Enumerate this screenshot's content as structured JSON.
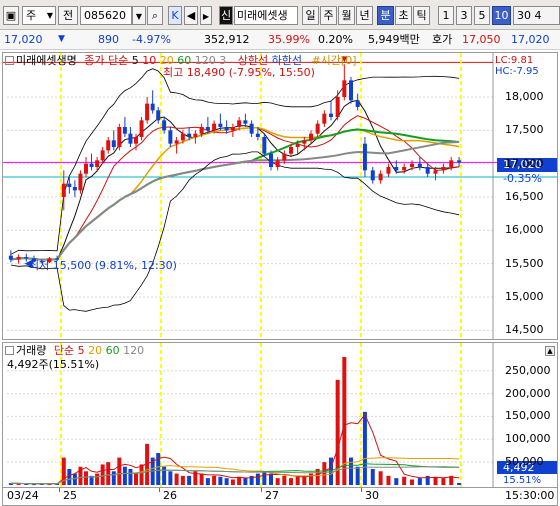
{
  "toolbar": {
    "market": "주",
    "period_btn": "전",
    "code": "085620",
    "k_btn": "K",
    "sin_badge": "신",
    "name": "미래에셋생",
    "periods": [
      "일",
      "주",
      "월",
      "년",
      "분",
      "초",
      "틱"
    ],
    "selected_period": "분",
    "intervals": [
      "1",
      "3",
      "5",
      "10",
      "30"
    ],
    "selected_interval": "10",
    "partial": "30 4"
  },
  "info": {
    "price": "17,020",
    "change": "890",
    "change_pct": "-4.97%",
    "volume": "352,912",
    "ratio": "35.99%",
    "turnover_pct": "0.20%",
    "amount": "5,949백만",
    "quote_label": "호가",
    "quote_price": "17,050",
    "quote_price2": "17,020"
  },
  "price_pane": {
    "legend_name": "미래에셋생명",
    "legend_ma_label": "종가 단순",
    "legend_ma_periods": [
      "5",
      "10",
      "20",
      "60",
      "120"
    ],
    "legend_extra_num": "3",
    "legend_limit": "상한선",
    "legend_lower": "하한선",
    "legend_time": "#시간[0]",
    "lc_label": "LC:9.81",
    "hc_label": "HC:-7.95",
    "high_annotation": "최고 18,490 (-7.95%, 15:50)",
    "low_annotation": "최저 15,500 (9.81%, 12:30)",
    "current_price_tag": "17,020",
    "current_pct_tag": "-0.35%",
    "y_ticks": [
      "18,000",
      "17,500",
      "17,000",
      "16,500",
      "16,000",
      "15,500",
      "15,000",
      "14,500"
    ]
  },
  "volume_pane": {
    "legend_label": "거래량",
    "legend_ma_label": "단순",
    "legend_ma_periods": [
      "5",
      "20",
      "60",
      "120"
    ],
    "volume_annotation": "4,492주(15.51%)",
    "current_volume_tag": "4,492",
    "current_volume_pct": "15.51%",
    "y_ticks": [
      "250,000",
      "200,000",
      "150,000",
      "100,000",
      "50,000"
    ]
  },
  "x_axis": {
    "labels": [
      "03/24",
      "25",
      "26",
      "27",
      "30"
    ],
    "time_label": "15:30:00"
  },
  "colors": {
    "up": "#e01010",
    "down": "#1040d0",
    "ma5": "#111111",
    "ma10": "#d01010",
    "ma20": "#e0a000",
    "ma60": "#10a020",
    "ma120": "#888888",
    "day_marker": "#ffff00",
    "current_line": "#ff00ff",
    "prev_line": "#00b0d0",
    "bollinger": "#000000"
  },
  "chart_data": {
    "type": "candlestick",
    "title": "",
    "price_axis": {
      "ylim": [
        14400,
        18600
      ]
    },
    "volume_axis": {
      "ylim": [
        0,
        280000
      ]
    },
    "high": {
      "value": 18490,
      "time": "15:50"
    },
    "low": {
      "value": 15500,
      "time": "12:30"
    },
    "current": 17020,
    "reference_price": 16800,
    "day_boundaries": [
      "25",
      "26",
      "27",
      "30"
    ],
    "candles": [
      [
        15620,
        15700,
        15520,
        15560
      ],
      [
        15560,
        15640,
        15500,
        15600
      ],
      [
        15600,
        15650,
        15530,
        15580
      ],
      [
        15580,
        15620,
        15520,
        15540
      ],
      [
        15540,
        15560,
        15500,
        15520
      ],
      [
        15520,
        15600,
        15510,
        15580
      ],
      [
        15580,
        15620,
        15540,
        15560
      ],
      [
        16500,
        16900,
        16300,
        16700
      ],
      [
        16700,
        16800,
        16550,
        16650
      ],
      [
        16650,
        16750,
        16500,
        16600
      ],
      [
        16600,
        16900,
        16550,
        16850
      ],
      [
        16850,
        17100,
        16800,
        17000
      ],
      [
        17000,
        17150,
        16900,
        16950
      ],
      [
        16950,
        17100,
        16900,
        17050
      ],
      [
        17050,
        17250,
        17000,
        17200
      ],
      [
        17200,
        17400,
        17150,
        17350
      ],
      [
        17350,
        17500,
        17200,
        17250
      ],
      [
        17250,
        17600,
        17200,
        17550
      ],
      [
        17550,
        17700,
        17400,
        17450
      ],
      [
        17450,
        17550,
        17250,
        17300
      ],
      [
        17300,
        17450,
        17200,
        17400
      ],
      [
        17400,
        17700,
        17350,
        17650
      ],
      [
        17650,
        18000,
        17600,
        17900
      ],
      [
        17900,
        18100,
        17750,
        17800
      ],
      [
        17800,
        17850,
        17600,
        17650
      ],
      [
        17650,
        17700,
        17450,
        17500
      ],
      [
        17500,
        17550,
        17250,
        17300
      ],
      [
        17300,
        17400,
        17150,
        17350
      ],
      [
        17350,
        17500,
        17300,
        17450
      ],
      [
        17450,
        17550,
        17350,
        17400
      ],
      [
        17400,
        17500,
        17300,
        17450
      ],
      [
        17450,
        17600,
        17400,
        17550
      ],
      [
        17550,
        17700,
        17450,
        17500
      ],
      [
        17500,
        17650,
        17450,
        17600
      ],
      [
        17600,
        17750,
        17500,
        17550
      ],
      [
        17550,
        17650,
        17450,
        17500
      ],
      [
        17500,
        17600,
        17400,
        17550
      ],
      [
        17550,
        17700,
        17500,
        17650
      ],
      [
        17650,
        17750,
        17550,
        17600
      ],
      [
        17600,
        17650,
        17400,
        17450
      ],
      [
        17450,
        17550,
        17350,
        17400
      ],
      [
        17400,
        17450,
        17100,
        17150
      ],
      [
        17150,
        17200,
        16900,
        16950
      ],
      [
        16950,
        17100,
        16900,
        17050
      ],
      [
        17050,
        17200,
        17000,
        17150
      ],
      [
        17150,
        17300,
        17100,
        17250
      ],
      [
        17250,
        17350,
        17150,
        17300
      ],
      [
        17300,
        17400,
        17200,
        17350
      ],
      [
        17350,
        17500,
        17300,
        17450
      ],
      [
        17450,
        17650,
        17400,
        17600
      ],
      [
        17600,
        17800,
        17550,
        17750
      ],
      [
        17750,
        17950,
        17650,
        17700
      ],
      [
        17700,
        18100,
        17650,
        18000
      ],
      [
        18000,
        18490,
        17950,
        18250
      ],
      [
        18250,
        18300,
        17900,
        17950
      ],
      [
        17950,
        18050,
        17800,
        17850
      ],
      [
        17300,
        17400,
        16800,
        16900
      ],
      [
        16900,
        16950,
        16700,
        16750
      ],
      [
        16750,
        16900,
        16700,
        16850
      ],
      [
        16850,
        17000,
        16800,
        16950
      ],
      [
        16950,
        17050,
        16850,
        16900
      ],
      [
        16900,
        17000,
        16850,
        16950
      ],
      [
        16950,
        17050,
        16900,
        17000
      ],
      [
        17000,
        17100,
        16900,
        16950
      ],
      [
        16950,
        17000,
        16800,
        16850
      ],
      [
        16850,
        16950,
        16750,
        16900
      ],
      [
        16900,
        17000,
        16850,
        16950
      ],
      [
        16950,
        17100,
        16900,
        17050
      ],
      [
        17050,
        17100,
        16950,
        17020
      ]
    ],
    "volumes": [
      4000,
      3000,
      2500,
      2000,
      3500,
      2000,
      3000,
      60000,
      35000,
      25000,
      40000,
      30000,
      20000,
      25000,
      45000,
      50000,
      30000,
      60000,
      40000,
      35000,
      25000,
      45000,
      90000,
      60000,
      70000,
      40000,
      30000,
      25000,
      20000,
      20000,
      30000,
      25000,
      15000,
      20000,
      18000,
      15000,
      12000,
      18000,
      15000,
      20000,
      25000,
      30000,
      25000,
      15000,
      20000,
      15000,
      18000,
      20000,
      25000,
      35000,
      50000,
      60000,
      230000,
      280000,
      60000,
      40000,
      160000,
      35000,
      30000,
      20000,
      15000,
      18000,
      12000,
      15000,
      20000,
      18000,
      15000,
      20000,
      4492
    ]
  }
}
